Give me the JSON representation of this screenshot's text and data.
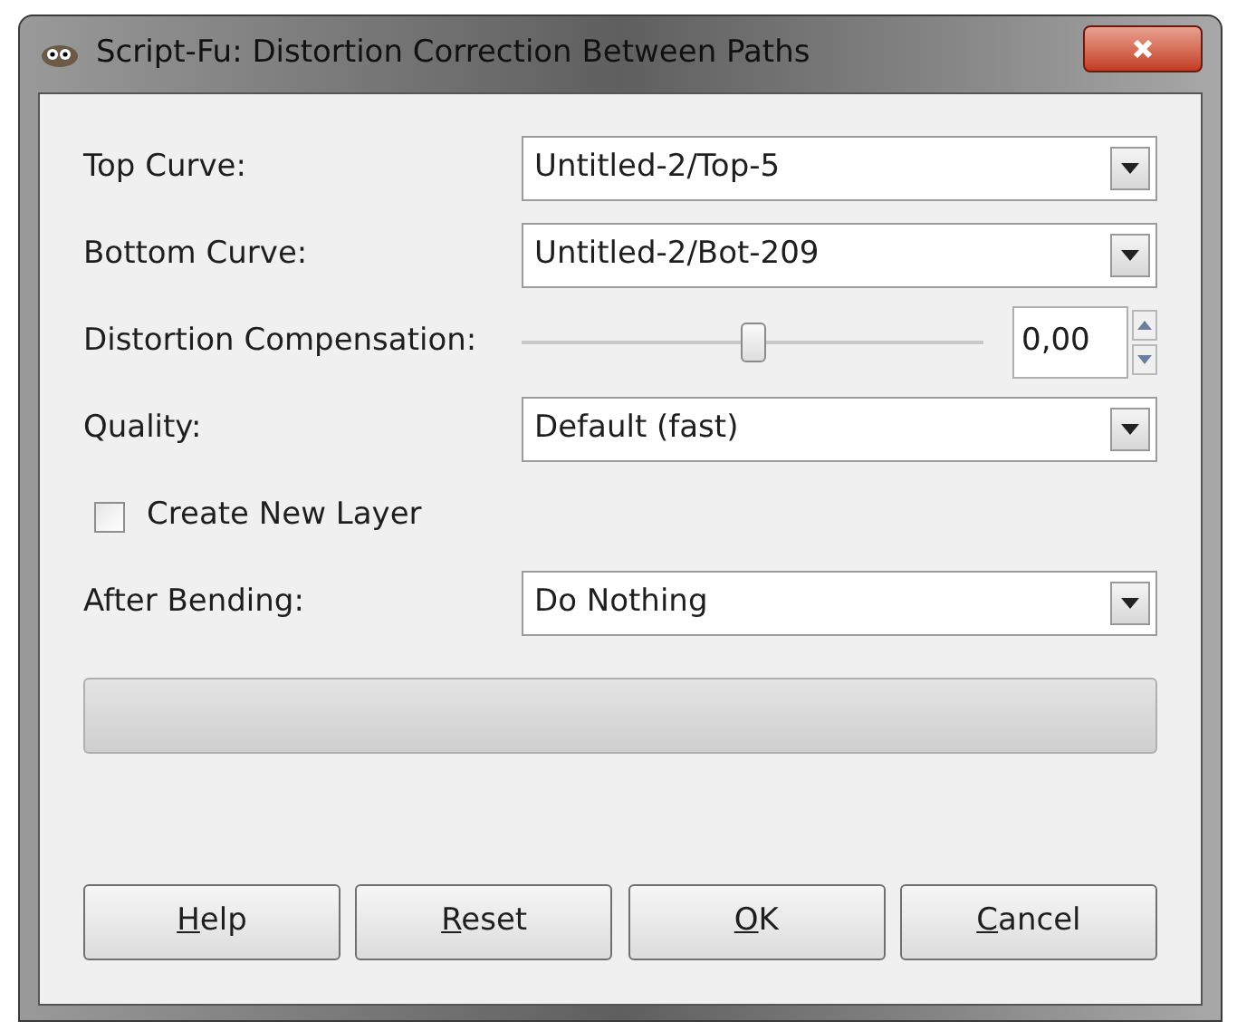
{
  "window": {
    "title": "Script-Fu: Distortion Correction Between Paths"
  },
  "fields": [
    {
      "kind": "dropdown",
      "label": "Top Curve:",
      "value": "Untitled-2/Top-5"
    },
    {
      "kind": "dropdown",
      "label": "Bottom Curve:",
      "value": "Untitled-2/Bot-209"
    },
    {
      "kind": "slider",
      "label": "Distortion Compensation:",
      "level": 0.5,
      "value": "0,00"
    },
    {
      "kind": "dropdown",
      "label": "Quality:",
      "value": "Default (fast)"
    },
    {
      "kind": "checkbox",
      "label": "Create New Layer",
      "checked": false
    },
    {
      "kind": "dropdown",
      "label": "After Bending:",
      "value": "Do Nothing"
    }
  ],
  "progress": {
    "level": 0
  },
  "buttons": [
    {
      "label": "Help",
      "mnemonic_underlined": true
    },
    {
      "label": "Reset",
      "mnemonic_underlined": true
    },
    {
      "label": "OK",
      "mnemonic_underlined": true
    },
    {
      "label": "Cancel",
      "mnemonic_underlined": true
    }
  ]
}
